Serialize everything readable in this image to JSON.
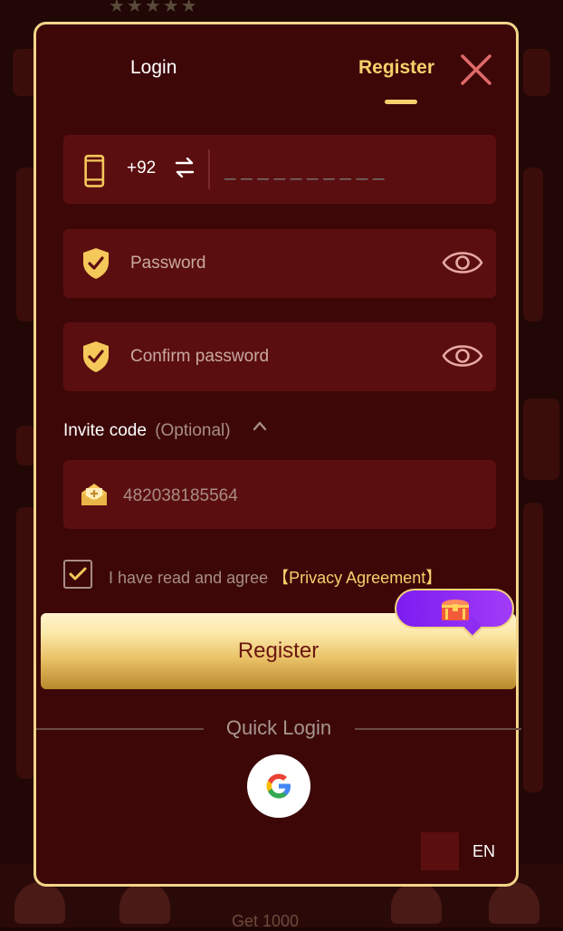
{
  "tabs": {
    "login": "Login",
    "register": "Register"
  },
  "phone": {
    "country_code": "+92",
    "placeholder": "__________"
  },
  "password": {
    "placeholder": "Password"
  },
  "confirm_password": {
    "placeholder": "Confirm password"
  },
  "invite": {
    "label": "Invite code",
    "optional": "(Optional)",
    "value": "482038185564"
  },
  "agreement": {
    "text": "I have read and agree ",
    "link": "【Privacy Agreement】",
    "checked": true
  },
  "register_button": "Register",
  "quick_login": "Quick Login",
  "language": "EN",
  "background": {
    "bottom_nav_text": "Get 1000"
  },
  "icons": {
    "close": "close-icon",
    "phone": "phone-icon",
    "swap": "swap-icon",
    "shield": "shield-check-icon",
    "eye": "eye-icon",
    "chevron": "chevron-up-icon",
    "envelope": "envelope-icon",
    "check": "check-icon",
    "chest": "treasure-chest-icon",
    "google": "google-icon"
  },
  "colors": {
    "accent": "#f5d06b",
    "modal_bg": "#3d0708",
    "field_bg": "#5b0e0f",
    "border": "#f2d58a",
    "promo": "#8f2cf3"
  }
}
